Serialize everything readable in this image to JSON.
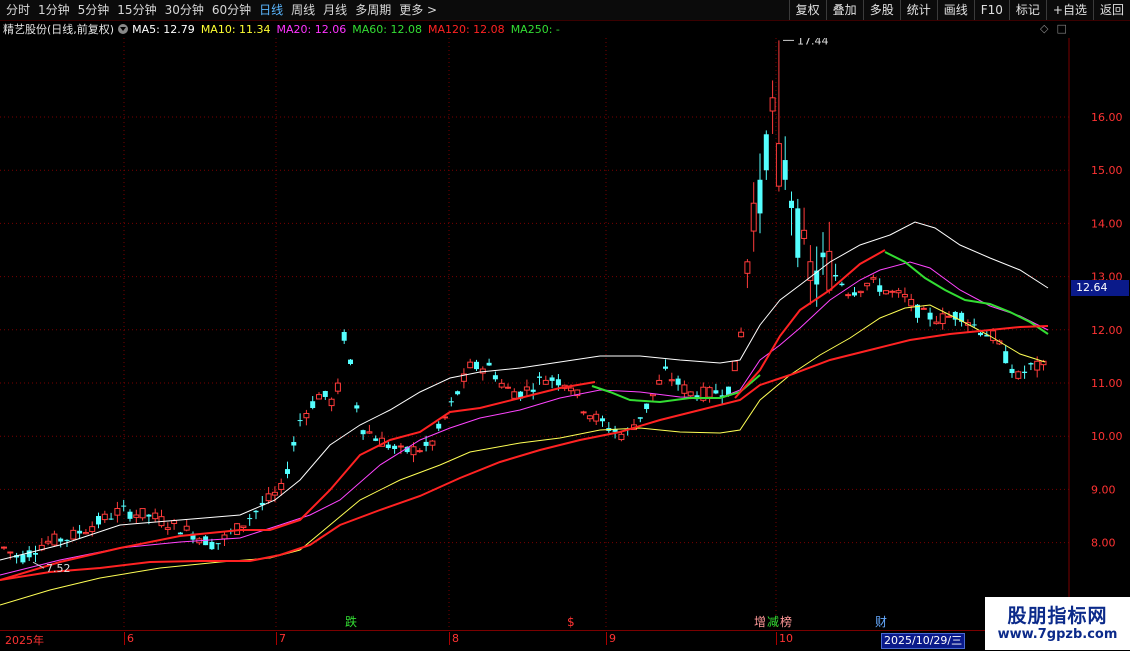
{
  "toolbar": {
    "periods": [
      "分时",
      "1分钟",
      "5分钟",
      "15分钟",
      "30分钟",
      "60分钟",
      "日线",
      "周线",
      "月线",
      "多周期",
      "更多 >"
    ],
    "active_period": "日线",
    "buttons": [
      "复权",
      "叠加",
      "多股",
      "统计",
      "画线",
      "F10",
      "标记",
      "+自选",
      "返回"
    ]
  },
  "info": {
    "title": "精艺股份(日线,前复权)",
    "ma": [
      {
        "label": "MA5: 12.79",
        "color": "#ffffff"
      },
      {
        "label": "MA10: 11.34",
        "color": "#ffff33"
      },
      {
        "label": "MA20: 12.06",
        "color": "#ff33ff"
      },
      {
        "label": "MA60: 12.08",
        "color": "#33dd33"
      },
      {
        "label": "MA120: 12.08",
        "color": "#ff2222"
      },
      {
        "label": "MA250: -",
        "color": "#33dd33"
      }
    ],
    "corner_icons": [
      "diamond-icon",
      "square-icon"
    ]
  },
  "price_axis": {
    "labels": [
      "16.00",
      "15.00",
      "14.00",
      "13.00",
      "12.00",
      "11.00",
      "10.00",
      "9.00",
      "8.00"
    ],
    "current_price": "12.64"
  },
  "annotations": {
    "high": "17.44",
    "low": "7.52"
  },
  "events": [
    {
      "label": "跌",
      "color": "#33dd33"
    },
    {
      "label": "$",
      "color": "#ff3333"
    },
    {
      "label": "增",
      "color": "#ff9999"
    },
    {
      "label": "减",
      "color": "#33dd33"
    },
    {
      "label": "榜",
      "color": "#ff9999"
    },
    {
      "label": "财",
      "color": "#66aaff"
    }
  ],
  "time_axis": {
    "labels": [
      "2025年",
      "6",
      "7",
      "8",
      "9",
      "10"
    ],
    "cursor_date": "2025/10/29/三"
  },
  "watermark": {
    "title": "股朋指标网",
    "url": "www.7gpzb.com"
  },
  "colors": {
    "up": "#ff3b3b",
    "down": "#54ffff",
    "grid": "#7a0000",
    "axis_text": "#ff3333"
  }
}
